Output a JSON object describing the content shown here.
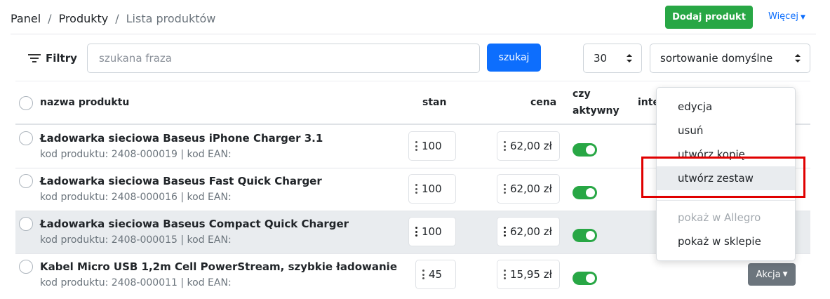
{
  "breadcrumb": {
    "items": [
      "Panel",
      "Produkty",
      "Lista produktów"
    ]
  },
  "header": {
    "add_label": "Dodaj produkt",
    "more_label": "Więcej"
  },
  "filters": {
    "label": "Filtry",
    "search_placeholder": "szukana fraza",
    "search_button": "szukaj",
    "per_page": "30",
    "sort": "sortowanie domyślne"
  },
  "table": {
    "columns": {
      "name": "nazwa produktu",
      "stock": "stan",
      "price": "cena",
      "active_line1": "czy",
      "active_line2": "aktywny",
      "integration": "inte"
    },
    "rows": [
      {
        "name": "Ładowarka sieciowa Baseus iPhone Charger 3.1",
        "meta": "kod produktu: 2408-000019 | kod EAN:",
        "stock": "100",
        "price": "62,00 zł",
        "active": true
      },
      {
        "name": "Ładowarka sieciowa Baseus Fast Quick Charger",
        "meta": "kod produktu: 2408-000016 | kod EAN:",
        "stock": "100",
        "price": "62,00 zł",
        "active": true
      },
      {
        "name": "Ładowarka sieciowa Baseus Compact Quick Charger",
        "meta": "kod produktu: 2408-000015 | kod EAN:",
        "stock": "100",
        "price": "62,00 zł",
        "active": true
      },
      {
        "name": "Kabel Micro USB 1,2m Cell PowerStream, szybkie ładowanie",
        "meta": "kod produktu: 2408-000011 | kod EAN:",
        "stock": "45",
        "price": "15,95 zł",
        "active": true
      }
    ],
    "action_label": "Akcja"
  },
  "menu": {
    "items": [
      "edycja",
      "usuń",
      "utwórz kopię",
      "utwórz zestaw",
      "pokaż w Allegro",
      "pokaż w sklepie"
    ]
  },
  "colors": {
    "primary": "#0d6efd",
    "success": "#28a745",
    "secondary": "#6c757d",
    "annotation": "#e00000"
  }
}
